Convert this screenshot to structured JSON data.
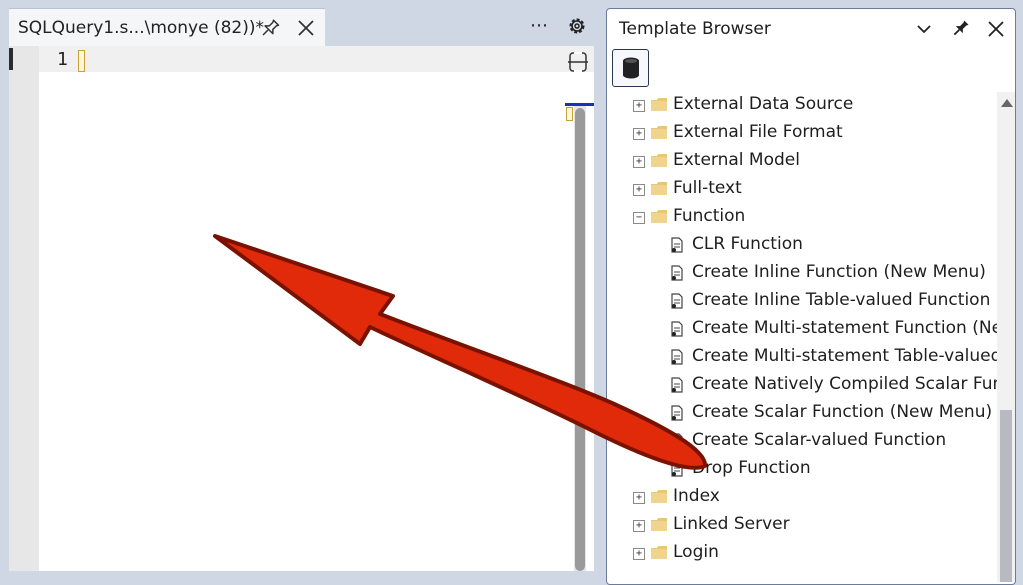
{
  "editor": {
    "tab_title": "SQLQuery1.s...\\monye (82))*",
    "line_number": "1",
    "more_label": "⋯"
  },
  "template_browser": {
    "title": "Template Browser",
    "tree": [
      {
        "label": "External Data Source",
        "type": "folder",
        "expanded": false
      },
      {
        "label": "External File Format",
        "type": "folder",
        "expanded": false
      },
      {
        "label": "External Model",
        "type": "folder",
        "expanded": false
      },
      {
        "label": "Full-text",
        "type": "folder",
        "expanded": false
      },
      {
        "label": "Function",
        "type": "folder",
        "expanded": true
      },
      {
        "label": "CLR Function",
        "type": "template"
      },
      {
        "label": "Create Inline Function (New Menu)",
        "type": "template"
      },
      {
        "label": "Create Inline Table-valued Function",
        "type": "template"
      },
      {
        "label": "Create Multi-statement Function (New",
        "type": "template"
      },
      {
        "label": "Create Multi-statement Table-valued F",
        "type": "template"
      },
      {
        "label": "Create Natively Compiled Scalar Funct",
        "type": "template"
      },
      {
        "label": "Create Scalar Function (New Menu)",
        "type": "template"
      },
      {
        "label": "Create Scalar-valued Function",
        "type": "template"
      },
      {
        "label": "Drop Function",
        "type": "template"
      },
      {
        "label": "Index",
        "type": "folder",
        "expanded": false
      },
      {
        "label": "Linked Server",
        "type": "folder",
        "expanded": false
      },
      {
        "label": "Login",
        "type": "folder",
        "expanded": false
      }
    ]
  },
  "colors": {
    "chrome_background": "#cfd6e4",
    "arrow_fill": "#e02a0a",
    "arrow_stroke": "#7a1200",
    "folder": "#e8c77a",
    "overview_mark": "#1c2fb5"
  }
}
